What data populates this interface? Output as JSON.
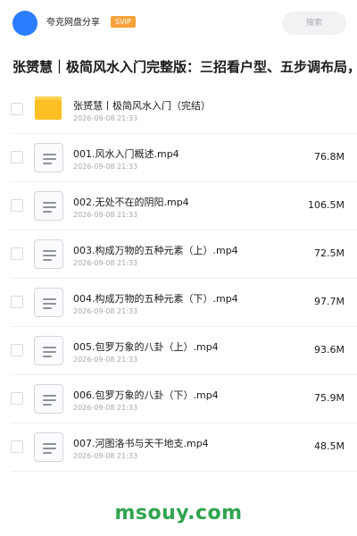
{
  "header": {
    "app_name": "夸克网盘分享",
    "badge": "SVIP",
    "search_placeholder": "搜索",
    "avatar_color": "#2b7cff",
    "badge_color": "#f7a23a"
  },
  "title": "张赟慧｜极简风水入门完整版：三招看户型、五步调布局，",
  "files": [
    {
      "type": "folder",
      "name": "张赟慧丨极简风水入门（完结）",
      "date": "2026-09-08 21:33",
      "size": ""
    },
    {
      "type": "video",
      "name": "001.风水入门概述.mp4",
      "date": "2026-09-08 21:33",
      "size": "76.8M"
    },
    {
      "type": "video",
      "name": "002.无处不在的阴阳.mp4",
      "date": "2026-09-08 21:33",
      "size": "106.5M"
    },
    {
      "type": "video",
      "name": "003.构成万物的五种元素（上）.mp4",
      "date": "2026-09-08 21:33",
      "size": "72.5M"
    },
    {
      "type": "video",
      "name": "004.构成万物的五种元素（下）.mp4",
      "date": "2026-09-08 21:33",
      "size": "97.7M"
    },
    {
      "type": "video",
      "name": "005.包罗万象的八卦（上）.mp4",
      "date": "2026-09-08 21:33",
      "size": "93.6M"
    },
    {
      "type": "video",
      "name": "006.包罗万象的八卦（下）.mp4",
      "date": "2026-09-08 21:33",
      "size": "75.9M"
    },
    {
      "type": "video",
      "name": "007.河图洛书与天干地支.mp4",
      "date": "2026-09-08 21:33",
      "size": "48.5M"
    }
  ],
  "watermark": "msouy.com",
  "watermark_color": "#2fa44f",
  "folder_color": "#fbbf24"
}
